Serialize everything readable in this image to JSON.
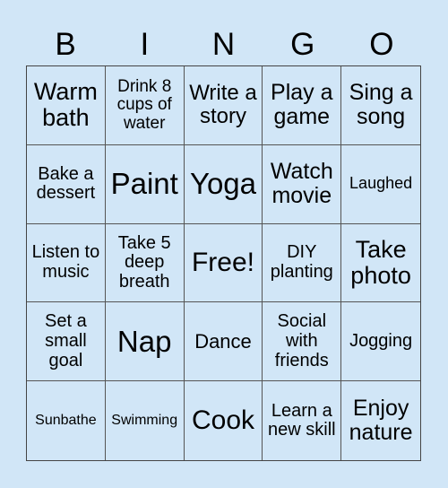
{
  "header": {
    "letters": [
      "B",
      "I",
      "N",
      "G",
      "O"
    ]
  },
  "colors": {
    "background": "#d1e6f7",
    "grid_line": "#555555"
  },
  "board": {
    "cells": [
      "Warm bath",
      "Drink 8 cups of water",
      "Write a story",
      "Play a game",
      "Sing a song",
      "Bake a dessert",
      "Paint",
      "Yoga",
      "Watch movie",
      "Laughed",
      "Listen to music",
      "Take 5 deep breath",
      "Free!",
      "DIY planting",
      "Take photo",
      "Set a small goal",
      "Nap",
      "Dance",
      "Social with friends",
      "Jogging",
      "Sunbathe",
      "Swimming",
      "Cook",
      "Learn a new skill",
      "Enjoy nature"
    ]
  }
}
